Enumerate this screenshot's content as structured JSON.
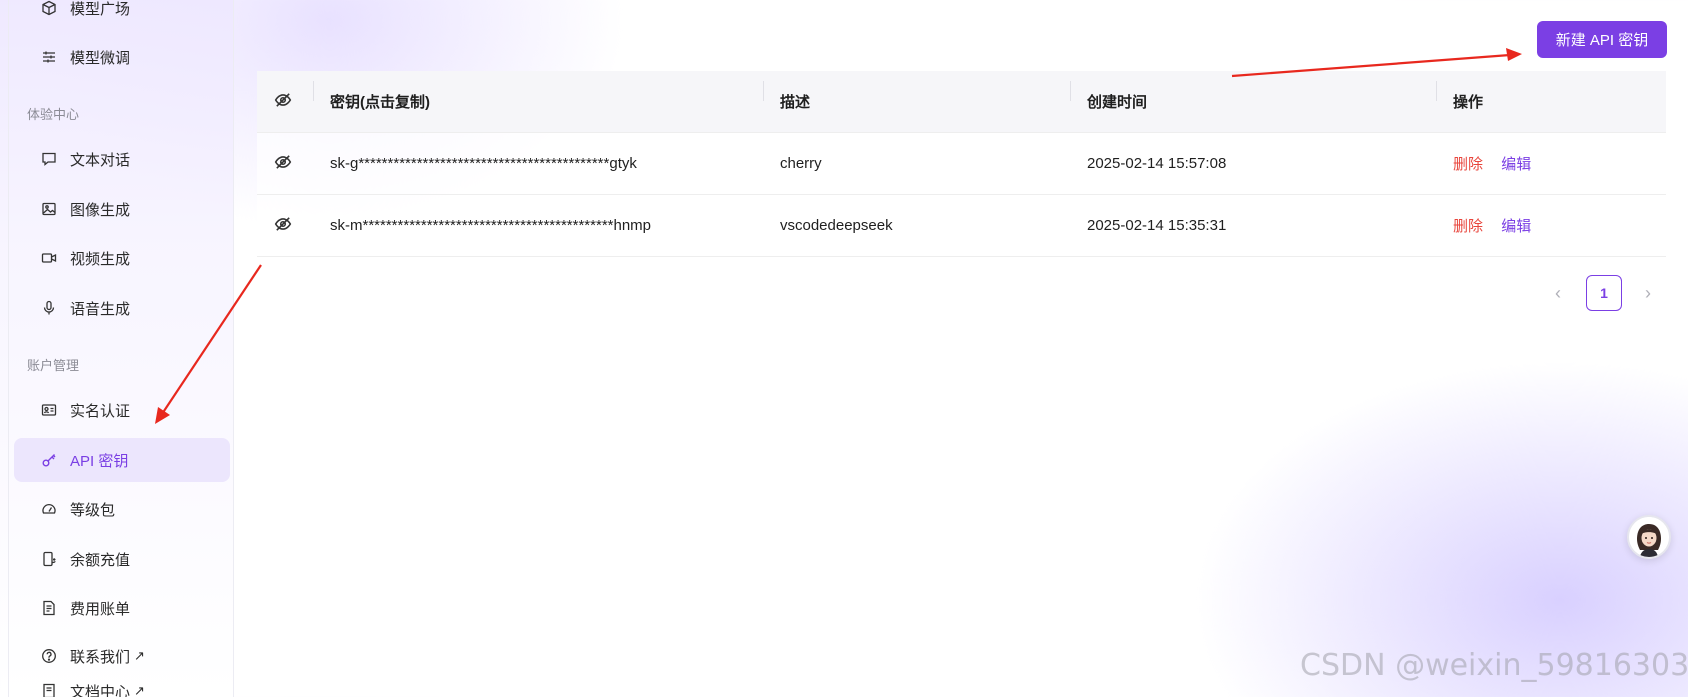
{
  "sidebar": {
    "top_items": [
      {
        "label": "模型广场",
        "icon": "cube-icon"
      },
      {
        "label": "模型微调",
        "icon": "sliders-icon"
      }
    ],
    "section_experience": "体验中心",
    "experience_items": [
      {
        "label": "文本对话",
        "icon": "chat-icon"
      },
      {
        "label": "图像生成",
        "icon": "image-icon"
      },
      {
        "label": "视频生成",
        "icon": "video-icon"
      },
      {
        "label": "语音生成",
        "icon": "microphone-icon"
      }
    ],
    "section_account": "账户管理",
    "account_items": [
      {
        "label": "实名认证",
        "icon": "id-card-icon"
      },
      {
        "label": "API 密钥",
        "icon": "key-icon",
        "active": true
      },
      {
        "label": "等级包",
        "icon": "gauge-icon"
      },
      {
        "label": "余额充值",
        "icon": "recharge-icon"
      },
      {
        "label": "费用账单",
        "icon": "bill-icon"
      }
    ],
    "footer_items": [
      {
        "label": "联系我们",
        "ext": "↗",
        "icon": "help-icon"
      },
      {
        "label": "文档中心",
        "ext": "↗",
        "icon": "doc-icon"
      }
    ]
  },
  "toolbar": {
    "new_key_label": "新建 API 密钥"
  },
  "table": {
    "headers": {
      "key": "密钥(点击复制)",
      "description": "描述",
      "created": "创建时间",
      "actions": "操作"
    },
    "rows": [
      {
        "key": "sk-g*******************************************gtyk",
        "description": "cherry",
        "created": "2025-02-14 15:57:08",
        "delete": "删除",
        "edit": "编辑"
      },
      {
        "key": "sk-m*******************************************hnmp",
        "description": "vscodedeepseek",
        "created": "2025-02-14 15:35:31",
        "delete": "删除",
        "edit": "编辑"
      }
    ]
  },
  "pagination": {
    "prev": "‹",
    "current_page": "1",
    "next": "›"
  },
  "watermark": "CSDN @weixin_59816303",
  "colors": {
    "accent": "#7b3fe4",
    "danger": "#e8453c",
    "annotation_arrow": "#e8281e"
  }
}
